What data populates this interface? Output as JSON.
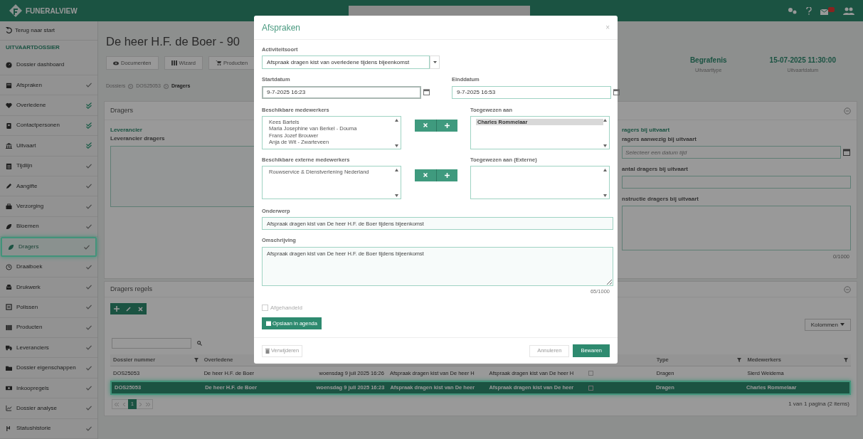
{
  "app": {
    "logo": "FUNERALVIEW"
  },
  "sidebar": {
    "back": "Terug naar start",
    "section": "UITVAARTDOSSIER",
    "items": [
      {
        "label": "Dossier dashboard",
        "checked": false,
        "verified": false,
        "selected": false
      },
      {
        "label": "Afspraken",
        "checked": true,
        "verified": false,
        "selected": false
      },
      {
        "label": "Overledene",
        "checked": true,
        "verified": true,
        "selected": false
      },
      {
        "label": "Contactpersonen",
        "checked": true,
        "verified": true,
        "selected": false
      },
      {
        "label": "Uitvaart",
        "checked": true,
        "verified": true,
        "selected": false
      },
      {
        "label": "Tijdlijn",
        "checked": true,
        "verified": false,
        "selected": false
      },
      {
        "label": "Aangifte",
        "checked": true,
        "verified": false,
        "selected": false
      },
      {
        "label": "Verzorging",
        "checked": true,
        "verified": false,
        "selected": false
      },
      {
        "label": "Bloemen",
        "checked": true,
        "verified": false,
        "selected": false
      },
      {
        "label": "Dragers",
        "checked": true,
        "verified": false,
        "selected": true
      },
      {
        "label": "Draaiboek",
        "checked": true,
        "verified": false,
        "selected": false
      },
      {
        "label": "Drukwerk",
        "checked": true,
        "verified": false,
        "selected": false
      },
      {
        "label": "Polissen",
        "checked": true,
        "verified": false,
        "selected": false
      },
      {
        "label": "Producten",
        "checked": true,
        "verified": false,
        "selected": false
      },
      {
        "label": "Leveranciers",
        "checked": true,
        "verified": false,
        "selected": false
      },
      {
        "label": "Dossier eigenschappen",
        "checked": true,
        "verified": false,
        "selected": false
      },
      {
        "label": "Inkoopregels",
        "checked": true,
        "verified": false,
        "selected": false
      },
      {
        "label": "Dossier analyse",
        "checked": true,
        "verified": false,
        "selected": false
      },
      {
        "label": "Statushistorie",
        "checked": true,
        "verified": false,
        "selected": false
      }
    ]
  },
  "header": {
    "title": "De heer H.F. de Boer - 90",
    "buttons": [
      "Documenten",
      "Wizard",
      "Producten"
    ],
    "breadcrumb": [
      "Dossiers",
      "DOS25053",
      "Dragers"
    ],
    "summary": [
      {
        "value": "Begrafenis",
        "label": "Uitvaarttype"
      },
      {
        "value": "15-07-2025 11:30:00",
        "label": "Uitvaartdatum"
      }
    ]
  },
  "dragers_panel": {
    "title": "Dragers",
    "supplier_heading": "Leverancier",
    "supplier_label": "Leverancier dragers",
    "right_heading": "ragers bij uitvaart",
    "fields": [
      {
        "kind": "date",
        "label": "ragers aanwezig bij uitvaart",
        "placeholder": "Selecteer een datum tijd"
      },
      {
        "kind": "text",
        "label": "antal dragers bij uitvaart"
      },
      {
        "kind": "textarea",
        "label": "nstructie dragers bij uitvaart",
        "counter": "0/1000"
      }
    ]
  },
  "rules_panel": {
    "title": "Dragers regels",
    "columns_button": "Kolommen",
    "table": {
      "columns": [
        {
          "label": "Dossier nummer"
        },
        {
          "label": "Overledene"
        },
        {},
        {},
        {},
        {
          "label": "Type"
        },
        {
          "label": "Medewerkers"
        }
      ],
      "rows": [
        {
          "selected": false,
          "checked": false,
          "cells": [
            "DOS25053",
            "De heer H.F. de Boer",
            "woensdag 9 juli 2025 16:26",
            "Afspraak dragen kist van De heer H",
            "Afspraak dragen kist van De heer H",
            "Dragen",
            "Sierd Weidema"
          ]
        },
        {
          "selected": true,
          "checked": false,
          "cells": [
            "DOS25053",
            "De heer H.F. de Boer",
            "woensdag 9 juli 2025 16:23",
            "Afspraak dragen kist van De heer",
            "Afspraak dragen kist van De heer",
            "Dragen",
            "Charles Rommelaar"
          ]
        }
      ]
    },
    "pager": {
      "pages": [
        {
          "label": "1",
          "selected": true
        }
      ],
      "summary": "1 van 1 pagina (2 items)"
    }
  },
  "modal": {
    "title": "Afspraken",
    "close": "×",
    "activity": {
      "label": "Activiteitsoort",
      "value": "Afspraak dragen kist van overledene tijdens bijeenkomst"
    },
    "start": {
      "label": "Startdatum",
      "value": "9-7-2025 16:23"
    },
    "end": {
      "label": "Einddatum",
      "value": "9-7-2025 16:53"
    },
    "lists": [
      {
        "available_label": "Beschikbare medewerkers",
        "available": [
          {
            "label": "Kees Bartels",
            "selected": false
          },
          {
            "label": "Maria Josephine van Berkel - Douma",
            "selected": false
          },
          {
            "label": "Frans Jozef Brouwer",
            "selected": false
          },
          {
            "label": "Anja de Wit - Zwarteveen",
            "selected": false
          }
        ],
        "assigned_label": "Toegewezen aan",
        "assigned": [
          {
            "label": "Charles Rommelaar",
            "selected": true
          }
        ]
      },
      {
        "available_label": "Beschikbare externe medewerkers",
        "available": [
          {
            "label": "Rouwservice & Dienstverlening Nederland",
            "selected": false
          }
        ],
        "assigned_label": "Toegewezen aan (Externe)"
      }
    ],
    "subject": {
      "label": "Onderwerp",
      "value": "Afspraak dragen kist van De heer H.F. de Boer tijdens bijeenkomst"
    },
    "description": {
      "label": "Omschrijving",
      "value": "Afspraak dragen kist van De heer H.F. de Boer tijdens bijeenkomst",
      "counter": "65/1000"
    },
    "done": {
      "label": "Afgehandeld",
      "checked": false
    },
    "agenda_button": "Opslaan in agenda",
    "delete_button": "Verwijderen",
    "cancel_button": "Annuleren",
    "save_button": "Bewaren"
  }
}
